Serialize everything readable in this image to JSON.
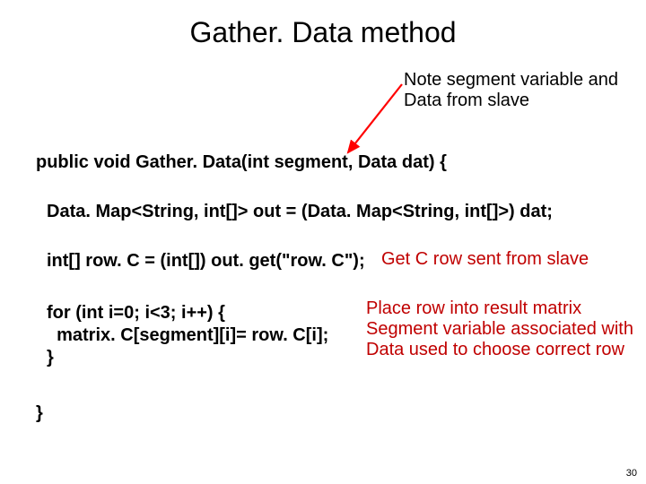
{
  "title": "Gather. Data method",
  "note": {
    "line1": "Note segment variable and",
    "line2": "Data from slave"
  },
  "code": {
    "signature": "public void Gather. Data(int segment, Data dat) {",
    "decl": "Data. Map<String, int[]> out = (Data. Map<String, int[]>) dat;",
    "rowc": "int[] row. C = (int[]) out. get(\"row. C\");",
    "loop1": "for (int i=0; i<3; i++) {",
    "loop2": "  matrix. C[segment][i]= row. C[i];",
    "loop3": "}",
    "close": "}"
  },
  "annotations": {
    "rowc": "Get C row sent from slave",
    "loop1": "Place row into result matrix",
    "loop2": "Segment variable associated with",
    "loop3": "Data used to choose correct row"
  },
  "page_number": "30",
  "colors": {
    "annotation_red": "#c00000",
    "arrow_red": "#ff0000"
  }
}
